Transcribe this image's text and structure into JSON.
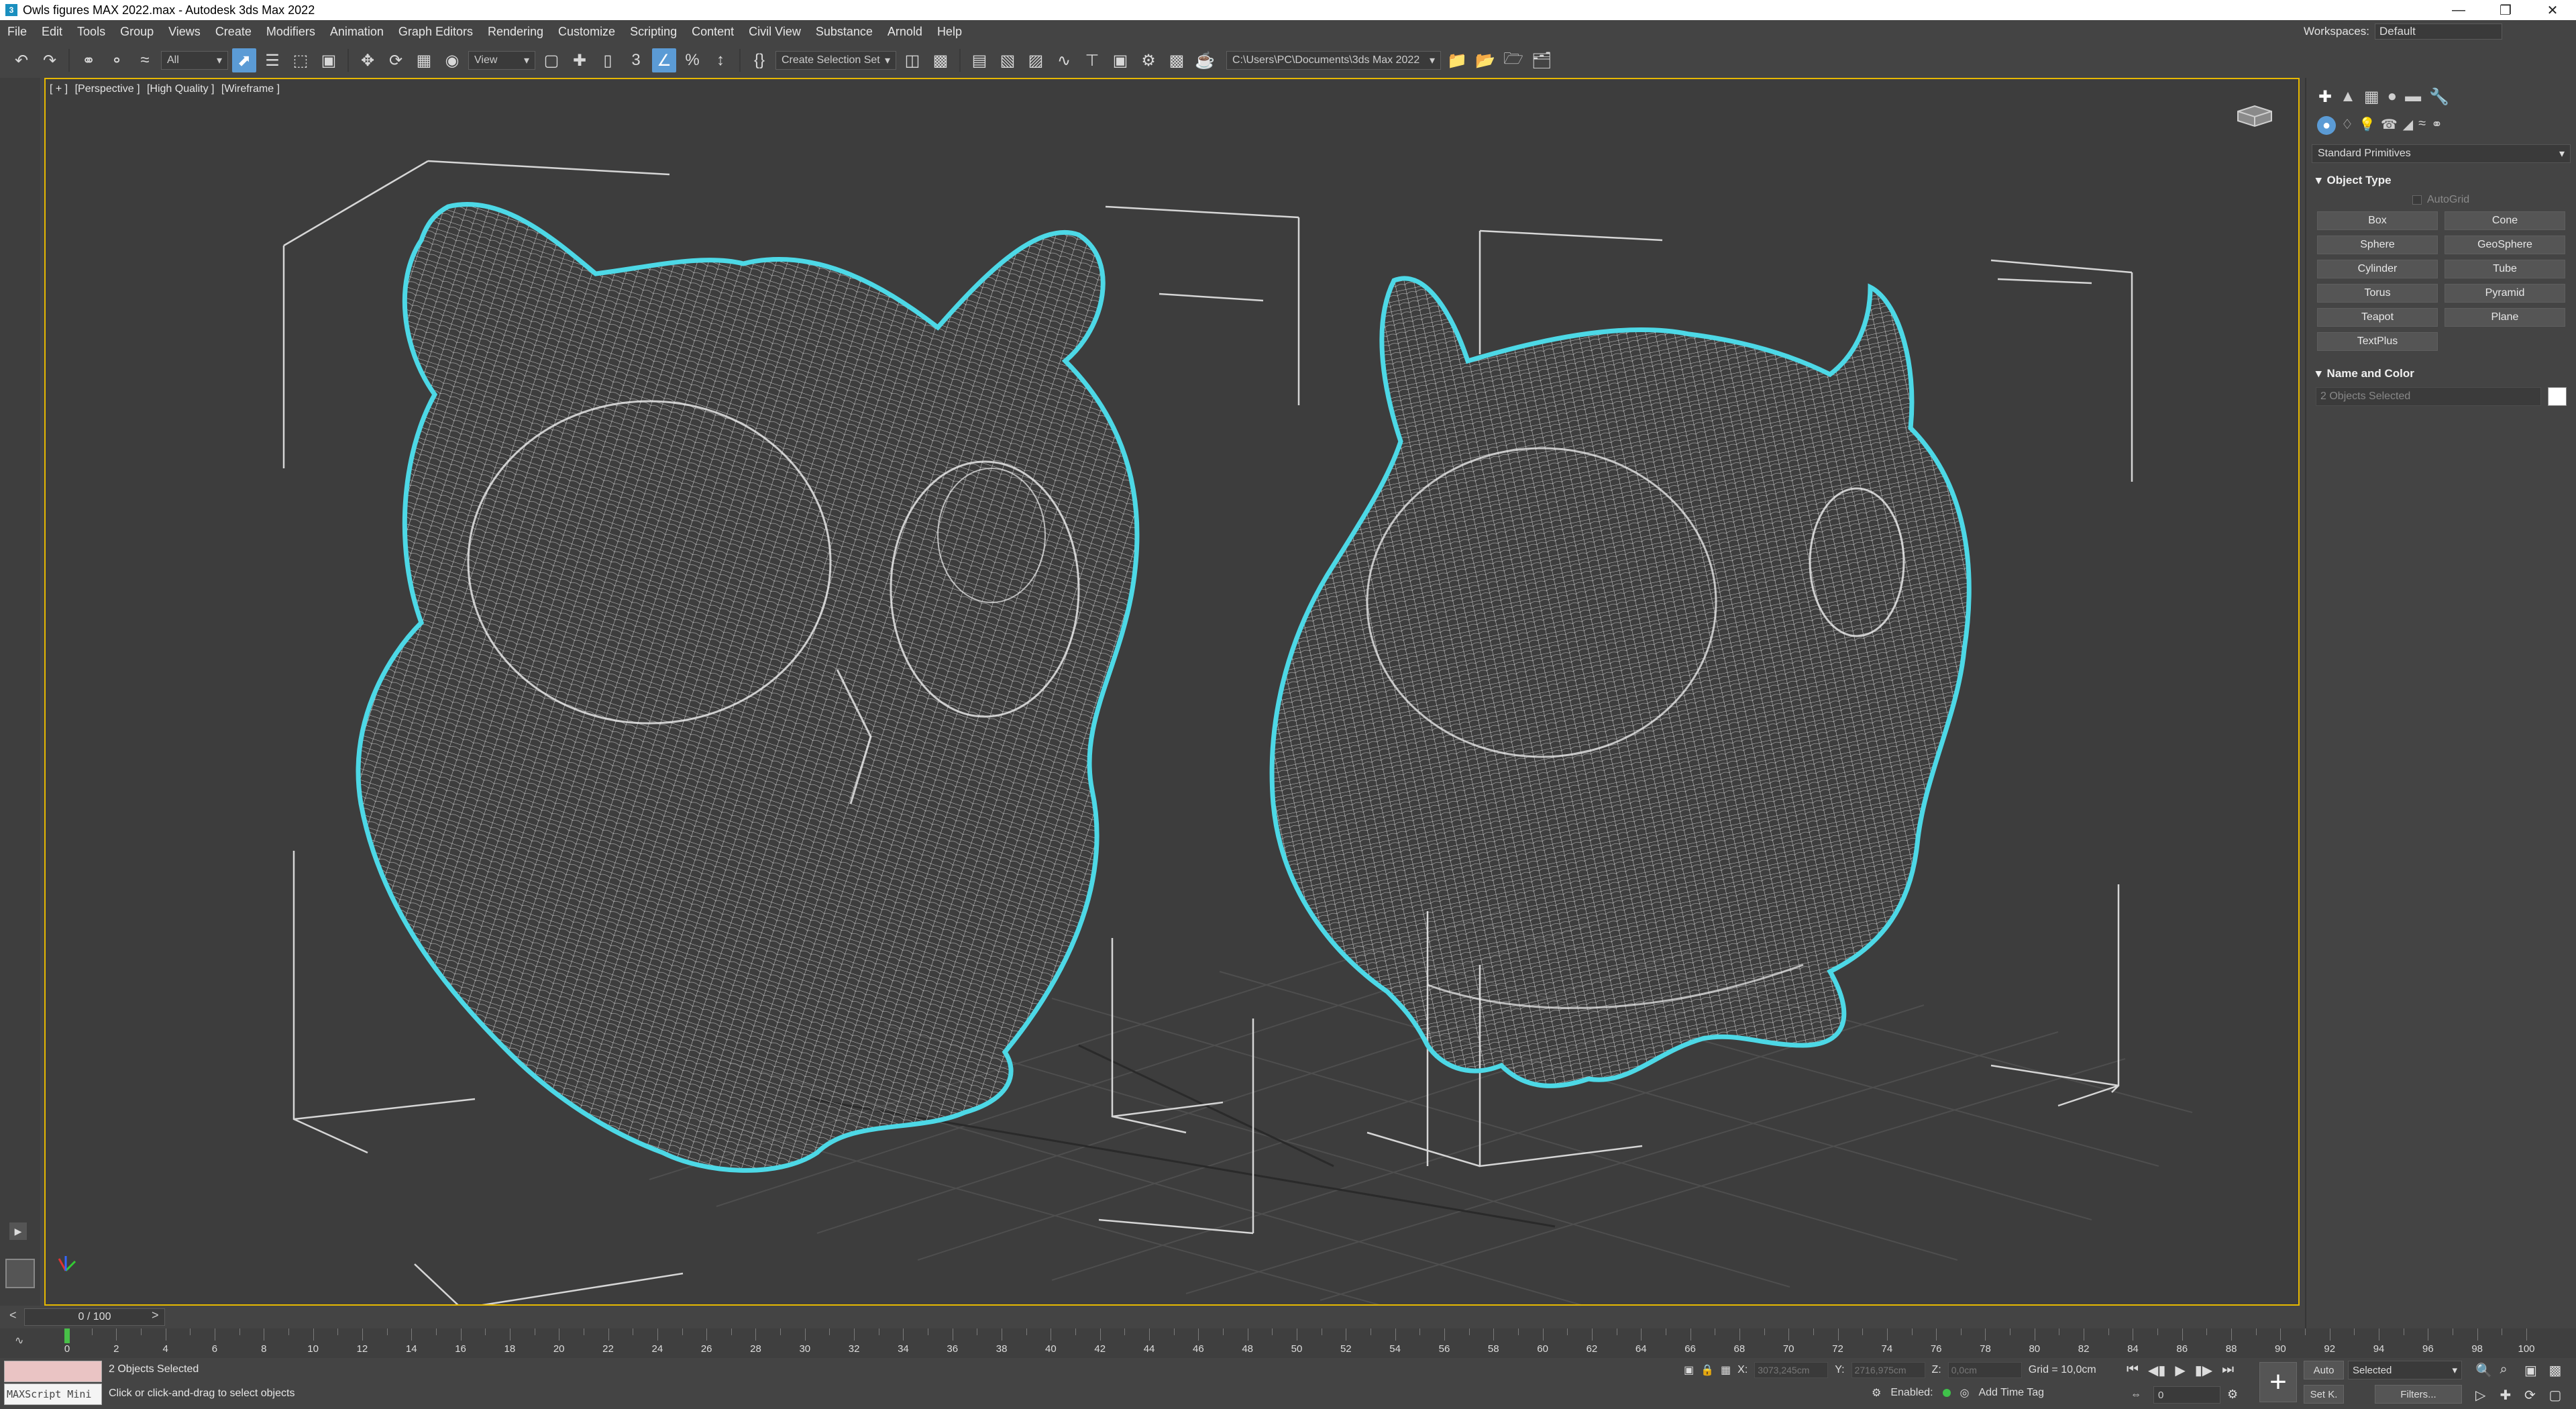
{
  "window": {
    "title": "Owls figures MAX 2022.max - Autodesk 3ds Max 2022",
    "app_icon": "3"
  },
  "menu": {
    "items": [
      "File",
      "Edit",
      "Tools",
      "Group",
      "Views",
      "Create",
      "Modifiers",
      "Animation",
      "Graph Editors",
      "Rendering",
      "Customize",
      "Scripting",
      "Content",
      "Civil View",
      "Substance",
      "Arnold",
      "Help"
    ],
    "workspaces_label": "Workspaces:",
    "workspace_value": "Default"
  },
  "toolbar": {
    "filter_value": "All",
    "refcoord_value": "View",
    "selection_set_placeholder": "Create Selection Set",
    "project_path": "C:\\Users\\PC\\Documents\\3ds Max 2022",
    "snap_label": "3"
  },
  "viewport": {
    "label_plus": "[ + ]",
    "label_view": "[Perspective ]",
    "label_quality": "[High Quality ]",
    "label_shading": "[Wireframe ]",
    "selection_color": "#4dd8e6",
    "border_color": "#e6b800"
  },
  "command_panel": {
    "category_dropdown": "Standard Primitives",
    "object_type_header": "Object Type",
    "autogrid_label": "AutoGrid",
    "primitives": [
      "Box",
      "Cone",
      "Sphere",
      "GeoSphere",
      "Cylinder",
      "Tube",
      "Torus",
      "Pyramid",
      "Teapot",
      "Plane",
      "TextPlus"
    ],
    "name_color_header": "Name and Color",
    "name_field_value": "2 Objects Selected",
    "object_color": "#ffffff"
  },
  "timeline": {
    "time_slider": "0 / 100",
    "prev_arrow": "<",
    "next_arrow": ">",
    "current_frame": 0,
    "tick_labels": [
      "0",
      "2",
      "4",
      "6",
      "8",
      "10",
      "12",
      "14",
      "16",
      "18",
      "20",
      "22",
      "24",
      "26",
      "28",
      "30",
      "32",
      "34",
      "36",
      "38",
      "40",
      "42",
      "44",
      "46",
      "48",
      "50",
      "52",
      "54",
      "56",
      "58",
      "60",
      "62",
      "64",
      "66",
      "68",
      "70",
      "72",
      "74",
      "76",
      "78",
      "80",
      "82",
      "84",
      "86",
      "88",
      "90",
      "92",
      "94",
      "96",
      "98",
      "100"
    ]
  },
  "status": {
    "maxscript_label": "MAXScript Mini",
    "selection_info": "2 Objects Selected",
    "prompt": "Click or click-and-drag to select objects",
    "x_label": "X:",
    "x_value": "3073,245cm",
    "y_label": "Y:",
    "y_value": "2716,975cm",
    "z_label": "Z:",
    "z_value": "0,0cm",
    "grid": "Grid = 10,0cm",
    "enabled_label": "Enabled:",
    "add_time_tag": "Add Time Tag",
    "auto_label": "Auto",
    "setk_label": "Set K.",
    "selected_value": "Selected",
    "filters_label": "Filters...",
    "frame_value": "0"
  }
}
